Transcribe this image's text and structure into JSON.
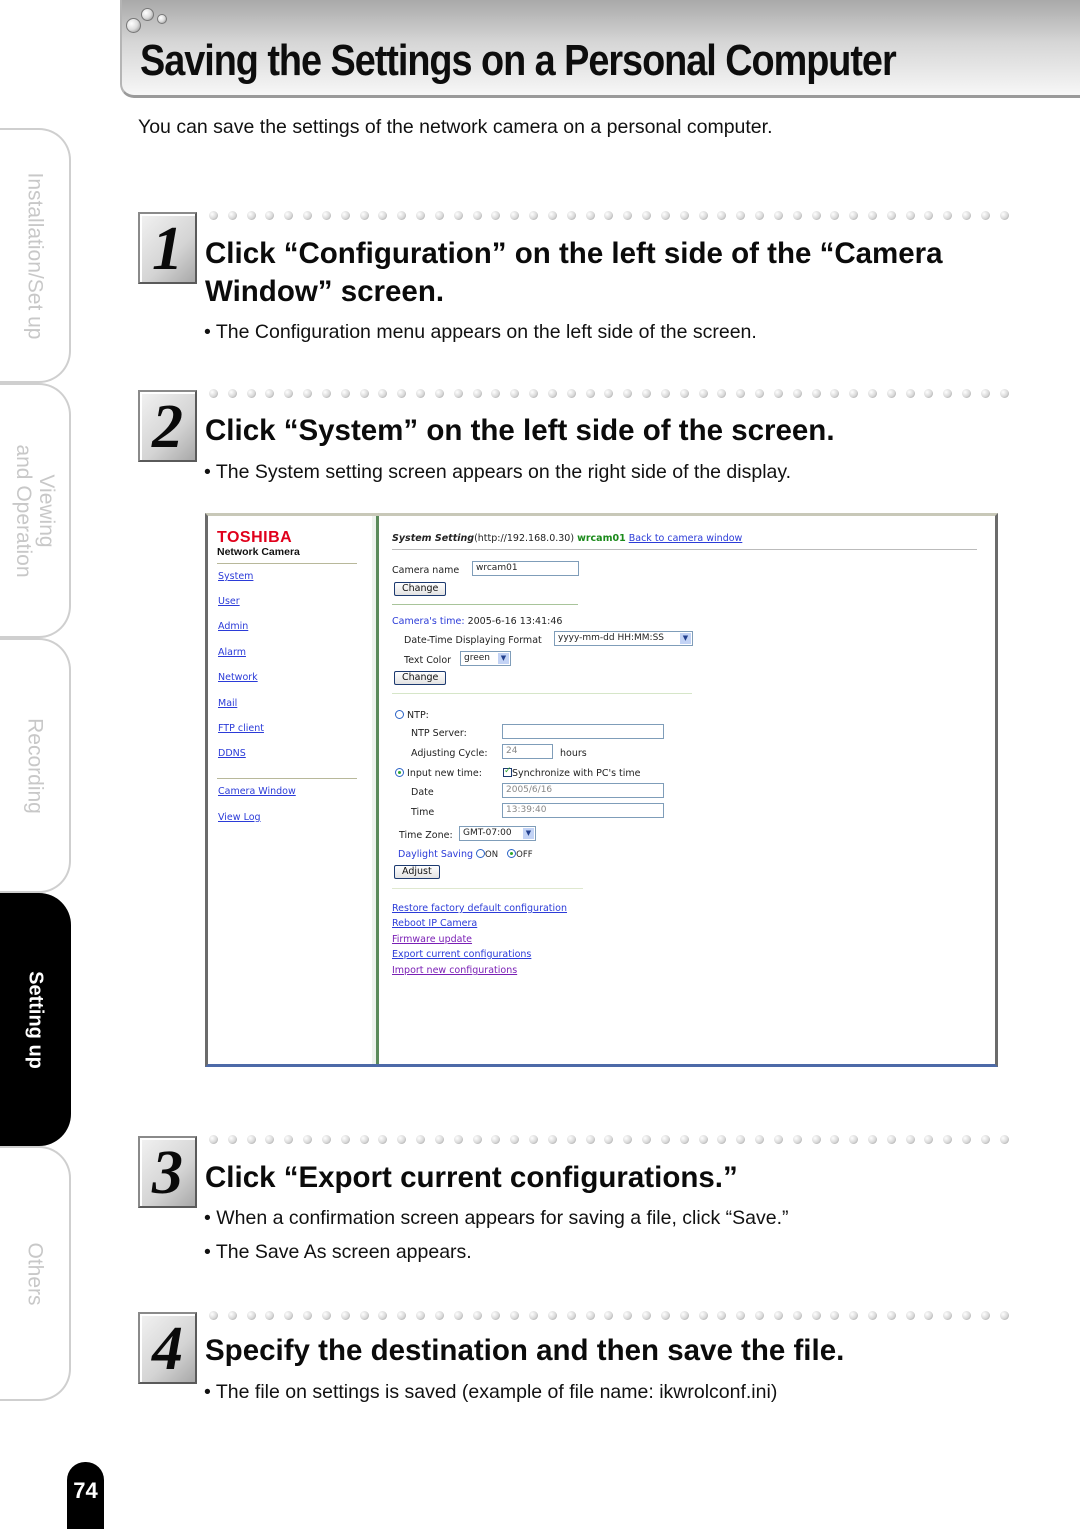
{
  "header": {
    "title": "Saving the Settings on a Personal Computer",
    "intro": "You can save the settings of the network camera on a personal computer."
  },
  "side_tabs": [
    {
      "label": "Installation/Set up",
      "active": false
    },
    {
      "label": "Viewing\nand Operation",
      "active": false
    },
    {
      "label": "Recording",
      "active": false
    },
    {
      "label": "Setting up",
      "active": true
    },
    {
      "label": "Others",
      "active": false
    }
  ],
  "page_number": "74",
  "steps": [
    {
      "number": "1",
      "heading_line1": "Click “Configuration” on the left side of the “Camera",
      "heading_line2": "Window” screen.",
      "bullets": [
        "• The Configuration menu appears on the left side of the screen."
      ]
    },
    {
      "number": "2",
      "heading": "Click “System” on the left side of the screen.",
      "bullets": [
        "• The System setting screen appears on the right side of the display."
      ]
    },
    {
      "number": "3",
      "heading": "Click “Export current configurations.”",
      "bullets": [
        "• When a confirmation screen appears for saving a file, click “Save.”",
        "• The Save As screen appears."
      ]
    },
    {
      "number": "4",
      "heading": "Specify the destination and then save the file.",
      "bullets": [
        "• The file on settings is saved (example of file name: ikwrolconf.ini)"
      ]
    }
  ],
  "screenshot": {
    "brand": "TOSHIBA",
    "brand_sub": "Network Camera",
    "nav_links": [
      "System",
      "User",
      "Admin",
      "Alarm",
      "Network",
      "Mail",
      "FTP client",
      "DDNS"
    ],
    "nav_links_bottom": [
      "Camera Window",
      "View Log"
    ],
    "title_bold": "System Setting",
    "title_url": "(http://192.168.0.30) ",
    "title_camera": "wrcam01",
    "back_link": "Back to camera window",
    "camera_name_label": "Camera name",
    "camera_name_value": "wrcam01",
    "change_label": "Change",
    "cameras_time_label": "Camera's time:",
    "cameras_time_value": "2005-6-16 13:41:46",
    "datetime_format_label": "Date-Time Displaying Format",
    "datetime_format_value": "yyyy-mm-dd HH:MM:SS",
    "text_color_label": "Text Color",
    "text_color_value": "green",
    "ntp_label": "NTP:",
    "ntp_server_label": "NTP Server:",
    "ntp_server_value": "",
    "adjusting_cycle_label": "Adjusting Cycle:",
    "adjusting_cycle_value": "24",
    "hours_label": "hours",
    "input_new_time_label": "Input new time:",
    "sync_pc_label": "Synchronize with PC's time",
    "sync_pc_checked": true,
    "date_label": "Date",
    "date_value": "2005/6/16",
    "time_label": "Time",
    "time_value": "13:39:40",
    "time_zone_label": "Time Zone:",
    "time_zone_value": "GMT-07:00",
    "daylight_label": "Daylight Saving",
    "daylight_on": "ON",
    "daylight_off": "OFF",
    "daylight_selected": "OFF",
    "adjust_label": "Adjust",
    "bottom_links": [
      {
        "label": "Restore factory default configuration",
        "visited": false
      },
      {
        "label": "Reboot IP Camera",
        "visited": false
      },
      {
        "label": "Firmware update",
        "visited": true
      },
      {
        "label": "Export current configurations",
        "visited": false
      },
      {
        "label": "Import new configurations",
        "visited": true
      }
    ]
  }
}
